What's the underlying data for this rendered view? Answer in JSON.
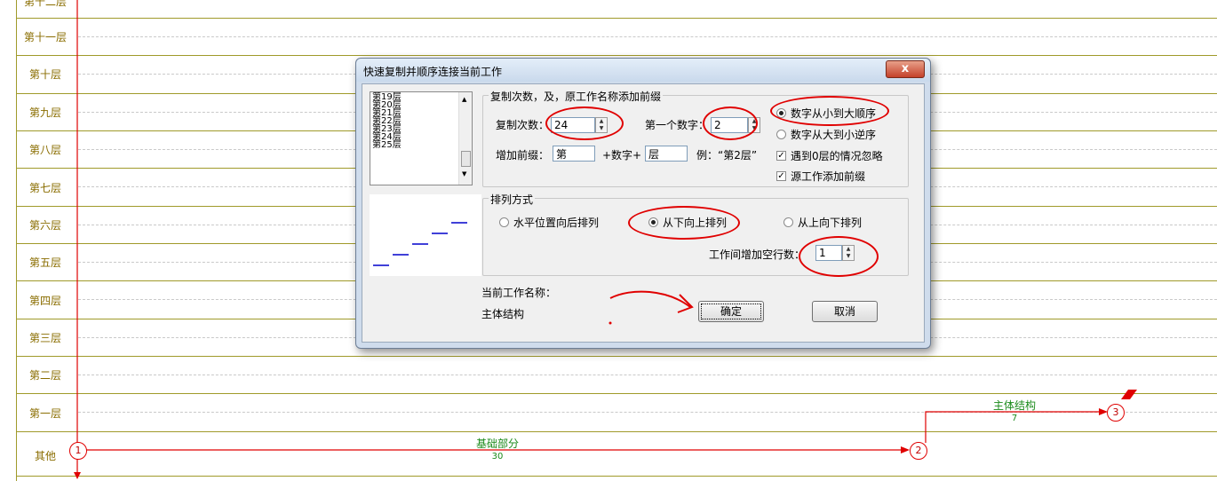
{
  "chart": {
    "rows": [
      {
        "label": "第十二层"
      },
      {
        "label": "第十一层"
      },
      {
        "label": "第十层"
      },
      {
        "label": "第九层"
      },
      {
        "label": "第八层"
      },
      {
        "label": "第七层"
      },
      {
        "label": "第六层"
      },
      {
        "label": "第五层"
      },
      {
        "label": "第四层"
      },
      {
        "label": "第三层"
      },
      {
        "label": "第二层"
      },
      {
        "label": "第一层"
      },
      {
        "label": "其他"
      }
    ],
    "works": [
      {
        "name": "基础部分",
        "duration": "30"
      },
      {
        "name": "主体结构",
        "duration": "7"
      }
    ],
    "nodes": [
      "1",
      "2",
      "3"
    ],
    "colors": {
      "arrow": "#e00000",
      "label": "#1a8a1a",
      "rowtext": "#8a6d00"
    }
  },
  "dialog": {
    "title": "快速复制并顺序连接当前工作",
    "close_label": "x",
    "list_items": [
      "第19层",
      "第20层",
      "第21层",
      "第22层",
      "第23层",
      "第24层",
      "第25层"
    ],
    "group1_legend": "复制次数，及，原工作名称添加前缀",
    "copy_count_label": "复制次数：",
    "copy_count_value": "24",
    "first_number_label": "第一个数字：",
    "first_number_value": "2",
    "radio_asc": "数字从小到大顺序",
    "radio_desc": "数字从大到小逆序",
    "check_ignore_zero": "遇到0层的情况忽略",
    "check_prefix_source": "源工作添加前缀",
    "prefix_label": "增加前缀：",
    "prefix_value": "第",
    "plus_number": "+数字+",
    "suffix_value": "层",
    "example": "例：“第2层”",
    "group2_legend": "排列方式",
    "arr_horizontal": "水平位置向后排列",
    "arr_bottom_up": "从下向上排列",
    "arr_top_down": "从上向下排列",
    "blank_rows_label": "工作间增加空行数：",
    "blank_rows_value": "1",
    "current_work_label": "当前工作名称：",
    "current_work_value": "主体结构",
    "ok_label": "确定",
    "cancel_label": "取消"
  }
}
